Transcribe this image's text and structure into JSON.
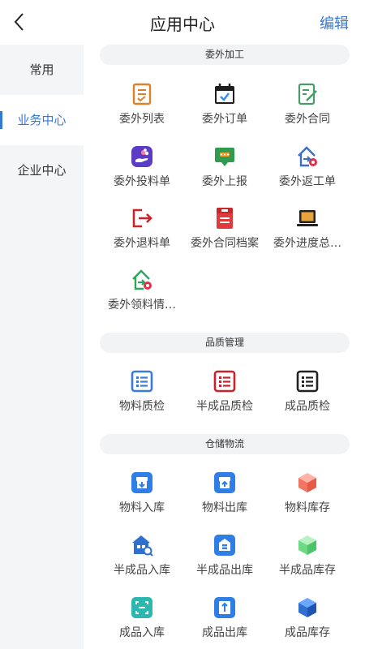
{
  "header": {
    "title": "应用中心",
    "edit_label": "编辑"
  },
  "sidebar": {
    "items": [
      {
        "label": "常用"
      },
      {
        "label": "业务中心"
      },
      {
        "label": "企业中心"
      }
    ]
  },
  "sections": [
    {
      "title": "委外加工",
      "items": [
        {
          "label": "委外列表",
          "icon": "outsource-list-icon"
        },
        {
          "label": "委外订单",
          "icon": "outsource-order-icon"
        },
        {
          "label": "委外合同",
          "icon": "outsource-contract-icon"
        },
        {
          "label": "委外投料单",
          "icon": "outsource-feeding-icon"
        },
        {
          "label": "委外上报",
          "icon": "outsource-report-icon"
        },
        {
          "label": "委外返工单",
          "icon": "outsource-rework-icon"
        },
        {
          "label": "委外退料单",
          "icon": "outsource-return-icon"
        },
        {
          "label": "委外合同档案",
          "icon": "outsource-contract-archive-icon"
        },
        {
          "label": "委外进度总…",
          "icon": "outsource-progress-icon"
        },
        {
          "label": "委外领料情…",
          "icon": "outsource-picking-icon"
        }
      ]
    },
    {
      "title": "品质管理",
      "items": [
        {
          "label": "物料质检",
          "icon": "material-qc-icon"
        },
        {
          "label": "半成品质检",
          "icon": "semi-product-qc-icon"
        },
        {
          "label": "成品质检",
          "icon": "product-qc-icon"
        }
      ]
    },
    {
      "title": "仓储物流",
      "items": [
        {
          "label": "物料入库",
          "icon": "material-inbound-icon"
        },
        {
          "label": "物料出库",
          "icon": "material-outbound-icon"
        },
        {
          "label": "物料库存",
          "icon": "material-stock-icon"
        },
        {
          "label": "半成品入库",
          "icon": "semi-inbound-icon"
        },
        {
          "label": "半成品出库",
          "icon": "semi-outbound-icon"
        },
        {
          "label": "半成品库存",
          "icon": "semi-stock-icon"
        },
        {
          "label": "成品入库",
          "icon": "product-inbound-icon"
        },
        {
          "label": "成品出库",
          "icon": "product-outbound-icon"
        },
        {
          "label": "成品库存",
          "icon": "product-stock-icon"
        }
      ]
    }
  ],
  "colors": {
    "accent": "#3478d8",
    "sidebar_bg": "#f4f5f7",
    "section_bg": "#f2f3f5"
  }
}
